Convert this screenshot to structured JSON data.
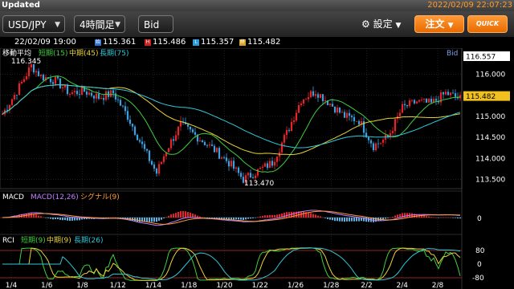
{
  "status": {
    "title": "Updated",
    "datetime": "2022/02/09 22:07:23"
  },
  "toolbar": {
    "pair": "USD/JPY",
    "interval": "4時間足",
    "price_type": "Bid",
    "settings": "設定",
    "order": "注文",
    "quick": "QUICK"
  },
  "ohlc": {
    "datetime": "22/02/09 19:00",
    "open": "115.361",
    "high": "115.486",
    "low": "115.357",
    "close": "115.482",
    "open_tag": "始",
    "high_tag": "H",
    "low_tag": "L",
    "close_tag": "終"
  },
  "main_chart": {
    "indicator_title": "移動平均",
    "short_label": "短期(15)",
    "mid_label": "中期(45)",
    "long_label": "長期(75)",
    "price_type_label": "Bid",
    "high_marker": "116.345",
    "low_marker": "113.470",
    "top_price": "116.557",
    "current_price": "115.482",
    "y_ticks": [
      "116.000",
      "115.500",
      "115.000",
      "114.500",
      "114.000",
      "113.500"
    ],
    "colors": {
      "up": "#e8232a",
      "down": "#3aa0e0",
      "short": "#3ecf3e",
      "mid": "#e8d23a",
      "long": "#2fc8d8",
      "current": "#f0c020"
    }
  },
  "macd": {
    "title": "MACD",
    "macd_label": "MACD(12,26)",
    "signal_label": "シグナル(9)",
    "zero_label": "0"
  },
  "rci": {
    "title": "RCI",
    "short_label": "短期(9)",
    "mid_label": "中期(9)",
    "long_label": "長期(26)",
    "upper": "80",
    "zero": "0",
    "lower": "-80"
  },
  "x_axis": {
    "labels": [
      "1/4",
      "1/6",
      "1/8",
      "1/12",
      "1/14",
      "1/18",
      "1/20",
      "1/22",
      "1/26",
      "1/28",
      "2/2",
      "2/4",
      "2/8"
    ]
  },
  "chart_data": {
    "type": "candlestick",
    "price_anchors": [
      [
        0,
        115.05
      ],
      [
        6,
        115.6
      ],
      [
        12,
        116.2
      ],
      [
        16,
        115.95
      ],
      [
        22,
        115.85
      ],
      [
        28,
        115.55
      ],
      [
        34,
        115.6
      ],
      [
        40,
        115.45
      ],
      [
        46,
        115.55
      ],
      [
        52,
        115.0
      ],
      [
        58,
        114.3
      ],
      [
        64,
        113.65
      ],
      [
        68,
        114.2
      ],
      [
        74,
        114.8
      ],
      [
        80,
        114.55
      ],
      [
        88,
        114.2
      ],
      [
        94,
        113.9
      ],
      [
        100,
        113.5
      ],
      [
        106,
        113.7
      ],
      [
        112,
        113.9
      ],
      [
        118,
        114.6
      ],
      [
        124,
        115.4
      ],
      [
        130,
        115.6
      ],
      [
        136,
        115.3
      ],
      [
        142,
        115.0
      ],
      [
        148,
        114.9
      ],
      [
        154,
        114.3
      ],
      [
        160,
        114.5
      ],
      [
        166,
        115.2
      ],
      [
        172,
        115.35
      ],
      [
        178,
        115.3
      ],
      [
        184,
        115.55
      ],
      [
        190,
        115.42
      ]
    ],
    "high": 116.345,
    "low": 113.47,
    "last": 115.482
  }
}
